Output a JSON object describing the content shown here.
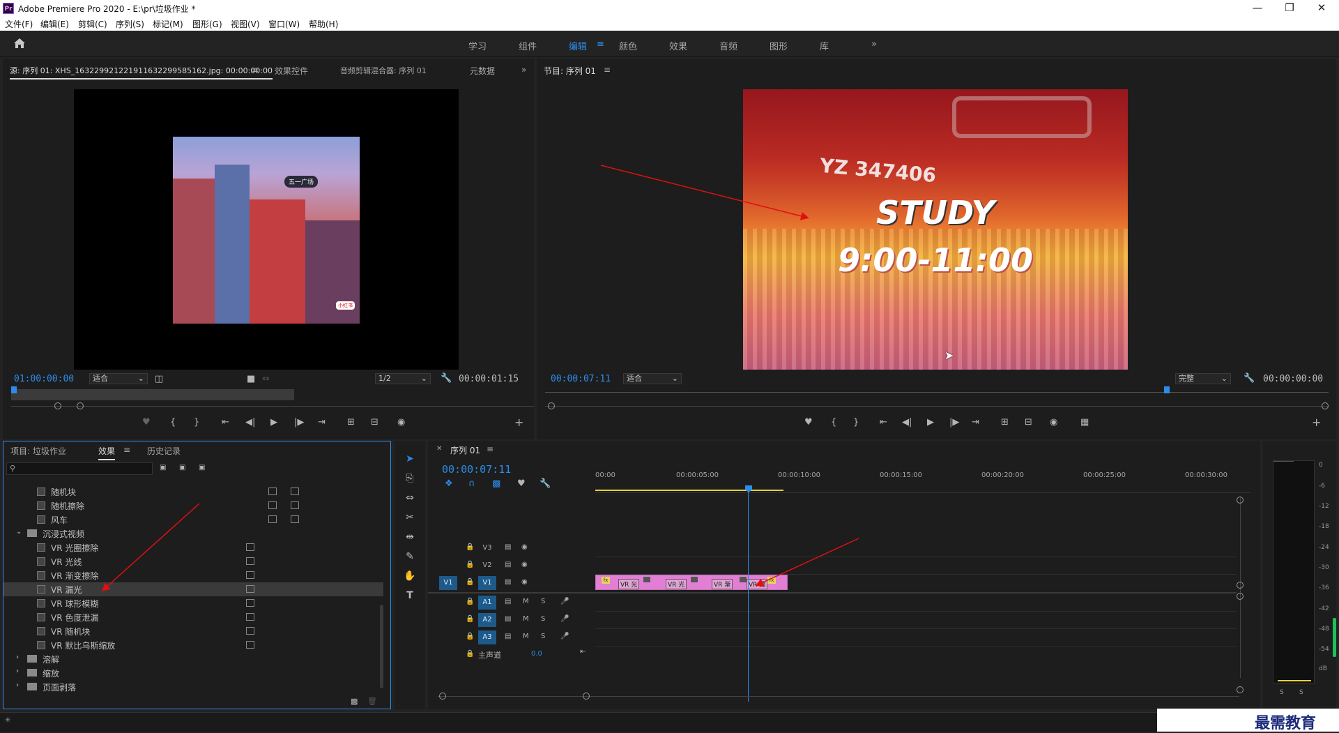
{
  "app": {
    "title": "Adobe Premiere Pro 2020 - E:\\pr\\垃圾作业 *",
    "logo": "Pr"
  },
  "menu": [
    "文件(F)",
    "编辑(E)",
    "剪辑(C)",
    "序列(S)",
    "标记(M)",
    "图形(G)",
    "视图(V)",
    "窗口(W)",
    "帮助(H)"
  ],
  "workspaces": [
    "学习",
    "组件",
    "编辑",
    "颜色",
    "效果",
    "音频",
    "图形",
    "库"
  ],
  "source_panel": {
    "tabs": [
      "源: 序列 01: XHS_16322992122191163229958516​2.jpg: 00:00:00:00",
      "效果控件",
      "音频剪辑混合器: 序列 01",
      "元数据"
    ],
    "timecode_in": "01:00:00:00",
    "fit": "适合",
    "resolution": "1/2",
    "timecode_dur": "00:00:01:15",
    "thumb_caption": "五一广场",
    "thumb_tag": "小红书"
  },
  "program_panel": {
    "tab": "节目: 序列 01",
    "timecode": "00:00:07:11",
    "fit": "适合",
    "quality": "完整",
    "timecode_end": "00:00:00:00",
    "overlay_title": "STUDY",
    "overlay_time": "9:00-11:00",
    "train_text": "YZ 347406"
  },
  "effects_panel": {
    "tabs": [
      "项目: 垃圾作业",
      "效果",
      "历史记录"
    ],
    "search_placeholder": "",
    "items": [
      {
        "label": "随机块",
        "type": "effect",
        "indent": 2
      },
      {
        "label": "随机擦除",
        "type": "effect",
        "indent": 2
      },
      {
        "label": "风车",
        "type": "effect",
        "indent": 2
      },
      {
        "label": "沉浸式视频",
        "type": "folder-open",
        "indent": 1
      },
      {
        "label": "VR 光圈擦除",
        "type": "effect",
        "indent": 2
      },
      {
        "label": "VR 光线",
        "type": "effect",
        "indent": 2
      },
      {
        "label": "VR 渐变擦除",
        "type": "effect",
        "indent": 2
      },
      {
        "label": "VR 漏光",
        "type": "effect",
        "indent": 2,
        "selected": true
      },
      {
        "label": "VR 球形模糊",
        "type": "effect",
        "indent": 2
      },
      {
        "label": "VR 色度泄漏",
        "type": "effect",
        "indent": 2
      },
      {
        "label": "VR 随机块",
        "type": "effect",
        "indent": 2
      },
      {
        "label": "VR 默比乌斯缩放",
        "type": "effect",
        "indent": 2
      },
      {
        "label": "溶解",
        "type": "folder",
        "indent": 1
      },
      {
        "label": "缩放",
        "type": "folder",
        "indent": 1
      },
      {
        "label": "页面剥落",
        "type": "folder",
        "indent": 1
      }
    ]
  },
  "timeline": {
    "tab": "序列 01",
    "timecode": "00:00:07:11",
    "ruler": [
      "00:00",
      "00:00:05:00",
      "00:00:10:00",
      "00:00:15:00",
      "00:00:20:00",
      "00:00:25:00",
      "00:00:30:00"
    ],
    "video_tracks": [
      "V3",
      "V2",
      "V1"
    ],
    "audio_tracks": [
      "A1",
      "A2",
      "A3"
    ],
    "source_patch": "V1",
    "master_label": "主声道",
    "master_value": "0.0",
    "clip_labels": [
      "VR 光",
      "VR 光",
      "VR 渐",
      "VR 漏"
    ],
    "track_buttons": {
      "mute": "M",
      "solo": "S"
    }
  },
  "meter": {
    "scale": [
      "0",
      "-6",
      "-12",
      "-18",
      "-24",
      "-30",
      "-36",
      "-42",
      "-48",
      "-54",
      "dB"
    ],
    "solo": [
      "S",
      "S"
    ]
  },
  "watermark": "最需教育",
  "colors": {
    "accent": "#2d8ceb",
    "clip": "#e07fd4",
    "playhead": "#2d8ceb",
    "workarea": "#e6d23a",
    "annotation": "#e01010"
  }
}
